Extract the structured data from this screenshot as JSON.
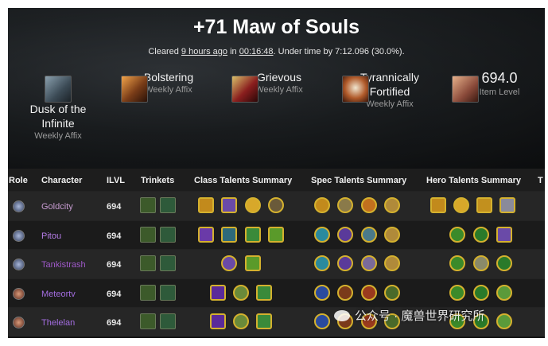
{
  "run": {
    "title": "+71 Maw of Souls",
    "cleared_prefix": "Cleared ",
    "cleared_ago": "9 hours ago",
    "cleared_in": " in ",
    "cleared_time": "00:16:48",
    "cleared_suffix": ". Under time by 7:12.096 (30.0%)."
  },
  "affixes": [
    {
      "line1": "Dusk of the",
      "line2": "Infinite",
      "sub": "Weekly Affix",
      "icon": "dusk-of-the-infinite-icon",
      "color": "#5a6d7a"
    },
    {
      "line1": "Bolstering",
      "line2": "",
      "sub": "Weekly Affix",
      "icon": "bolstering-icon",
      "color": "#7a3d18"
    },
    {
      "line1": "Grievous",
      "line2": "",
      "sub": "Weekly Affix",
      "icon": "grievous-icon",
      "color": "#8a1e1e"
    },
    {
      "line1": "Tyrannically",
      "line2": "Fortified",
      "sub": "Weekly Affix",
      "icon": "tyrannically-fortified-icon",
      "color": "#b05a2a"
    }
  ],
  "item_level": {
    "value": "694.0",
    "label": "Item Level",
    "icon": "item-level-arm-icon"
  },
  "table": {
    "headers": [
      "Role",
      "Character",
      "ILVL",
      "Trinkets",
      "Class Talents Summary",
      "Spec Talents Summary",
      "Hero Talents Summary",
      "T"
    ],
    "rows": [
      {
        "name": "Goldcity",
        "name_color": "#c69bd0",
        "ilvl": "694",
        "role": "tank-role-icon",
        "class_count": 4,
        "spec_count": 4,
        "hero_count": 4
      },
      {
        "name": "Pitou",
        "name_color": "#b57ce6",
        "ilvl": "694",
        "role": "tank-role-icon",
        "class_count": 4,
        "spec_count": 4,
        "hero_count": 3
      },
      {
        "name": "Tankistrash",
        "name_color": "#9f59c9",
        "ilvl": "694",
        "role": "tank-role-icon",
        "class_count": 2,
        "spec_count": 4,
        "hero_count": 3
      },
      {
        "name": "Meteortv",
        "name_color": "#a36de0",
        "ilvl": "694",
        "role": "dps-role-icon",
        "class_count": 3,
        "spec_count": 4,
        "hero_count": 3
      },
      {
        "name": "Thelelan",
        "name_color": "#a36de0",
        "ilvl": "694",
        "role": "dps-role-icon",
        "class_count": 3,
        "spec_count": 4,
        "hero_count": 3
      }
    ]
  },
  "watermark": {
    "text": "公众号 · 魔兽世界研究所"
  },
  "colors": {
    "talent_border": "#d4b12e",
    "class_icon_colors": [
      "#c28a1c",
      "#6a4aa8",
      "#3a8a3a",
      "#2e6a7a"
    ],
    "spec_icon_colors": [
      "#2a8a9e",
      "#5a3a9a",
      "#c2701e",
      "#4a6a2a"
    ],
    "hero_icon_colors": [
      "#3a8a2a",
      "#c28a1c",
      "#6a4aa8"
    ]
  }
}
